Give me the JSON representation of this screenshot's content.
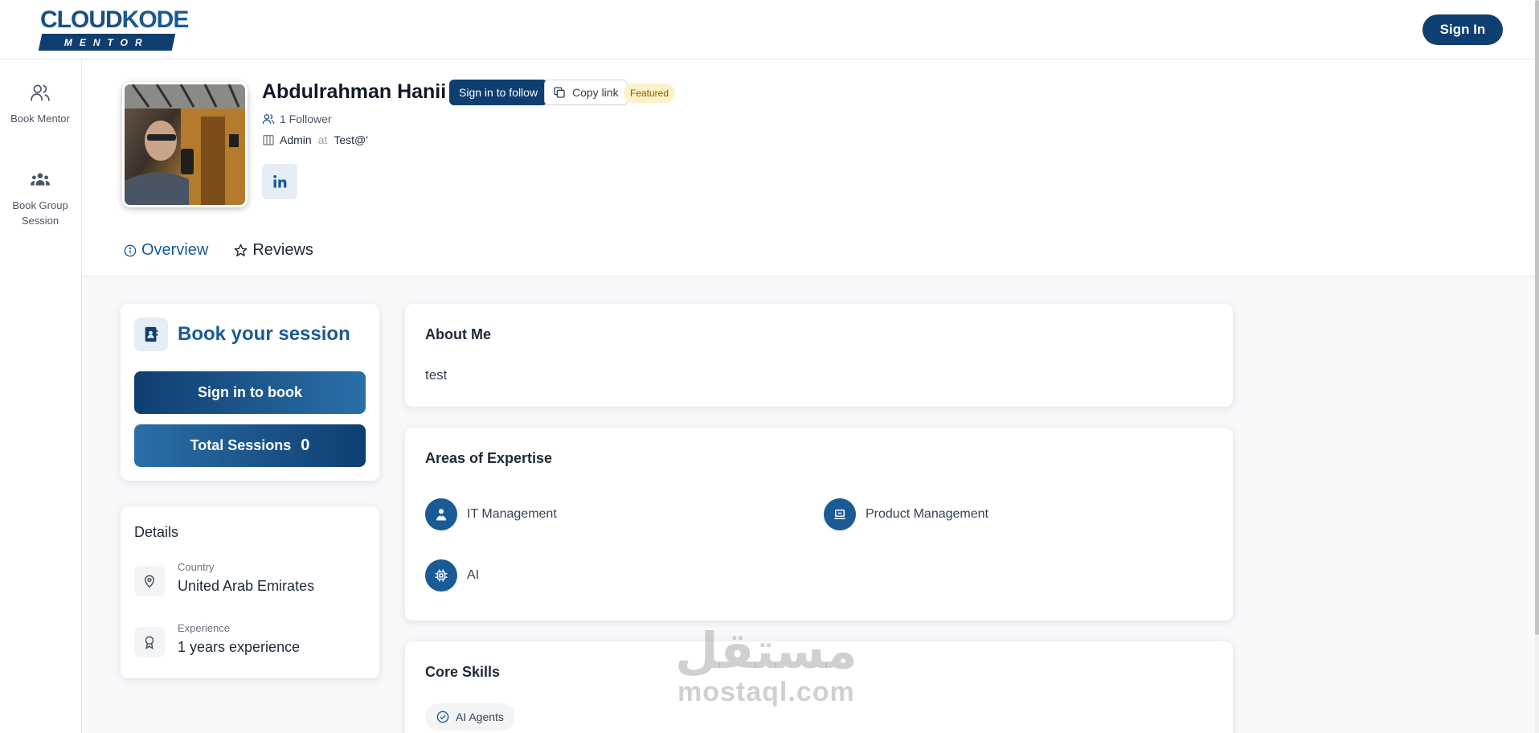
{
  "brand": {
    "logo_main": "CLOUD",
    "logo_accent": "KODE",
    "logo_sub": "MENTOR"
  },
  "header": {
    "signin_label": "Sign In"
  },
  "sidebar": {
    "items": [
      {
        "label": "Book Mentor",
        "icon": "users-icon"
      },
      {
        "label": "Book Group Session",
        "icon": "group-icon"
      }
    ]
  },
  "profile": {
    "name": "Abdulrahman Hanii",
    "follow_label": "Sign in to follow",
    "copy_label": "Copy link",
    "featured_label": "Featured",
    "followers": "1 Follower",
    "role": "Admin",
    "at": "at",
    "company": "Test@'",
    "linkedin_icon": "linkedin-icon"
  },
  "tabs": [
    {
      "label": "Overview",
      "active": true
    },
    {
      "label": "Reviews",
      "active": false
    }
  ],
  "booking": {
    "title": "Book your session",
    "book_label": "Sign in to book",
    "sessions_label": "Total Sessions",
    "sessions_count": "0"
  },
  "details": {
    "title": "Details",
    "country_label": "Country",
    "country_value": "United Arab Emirates",
    "experience_label": "Experience",
    "experience_value": "1 years experience"
  },
  "about": {
    "title": "About Me",
    "text": "test"
  },
  "expertise": {
    "title": "Areas of Expertise",
    "items": [
      "IT Management",
      "Product Management",
      "AI"
    ]
  },
  "skills": {
    "title": "Core Skills",
    "items": [
      "AI Agents"
    ]
  },
  "watermark": {
    "ar": "مستقل",
    "en": "mostaql.com"
  },
  "colors": {
    "primary": "#0f3e70",
    "accent": "#1a5a95",
    "featured_bg": "#fdf1c7"
  }
}
